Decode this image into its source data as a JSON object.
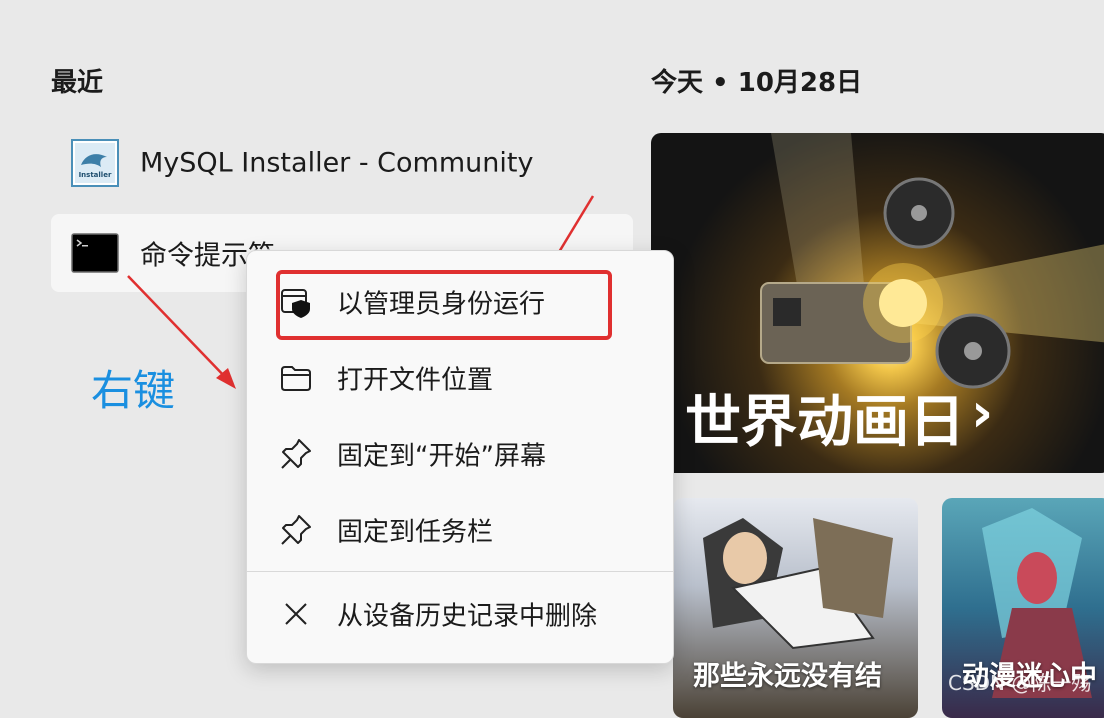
{
  "recent": {
    "title": "最近",
    "items": [
      {
        "label": "MySQL Installer - Community",
        "icon": "mysql-installer-icon"
      },
      {
        "label": "命令提示符",
        "icon": "command-prompt-icon"
      }
    ]
  },
  "today": {
    "title": "今天 • 10月28日",
    "hero": {
      "title": "世界动画日",
      "chevron": "›"
    },
    "cards": [
      {
        "title": "那些永远没有结"
      },
      {
        "title": "动漫迷心中"
      }
    ]
  },
  "context_menu": {
    "items": [
      {
        "label": "以管理员身份运行",
        "icon": "shield-icon"
      },
      {
        "label": "打开文件位置",
        "icon": "folder-icon"
      },
      {
        "label": "固定到“开始”屏幕",
        "icon": "pin-icon"
      },
      {
        "label": "固定到任务栏",
        "icon": "pin-icon"
      },
      {
        "label": "从设备历史记录中删除",
        "icon": "close-icon"
      }
    ]
  },
  "annotation": {
    "text": "右键"
  },
  "watermark": "CSDN @陈一殇",
  "colors": {
    "annotation_blue": "#1a8fe0",
    "annotation_red": "#e03030"
  }
}
